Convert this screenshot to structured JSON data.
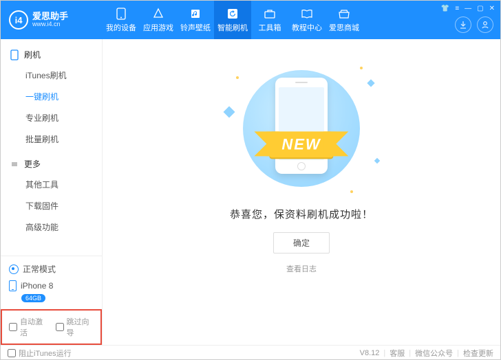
{
  "brand": {
    "logo_text": "i4",
    "title": "爱思助手",
    "url": "www.i4.cn"
  },
  "nav": {
    "items": [
      {
        "label": "我的设备",
        "icon": "phone-icon"
      },
      {
        "label": "应用游戏",
        "icon": "apps-icon"
      },
      {
        "label": "铃声壁纸",
        "icon": "music-icon"
      },
      {
        "label": "智能刷机",
        "icon": "refresh-icon",
        "active": true
      },
      {
        "label": "工具箱",
        "icon": "toolbox-icon"
      },
      {
        "label": "教程中心",
        "icon": "book-icon"
      },
      {
        "label": "爱思商城",
        "icon": "store-icon"
      }
    ]
  },
  "window_controls": {
    "cart": "⛶",
    "menu": "≡",
    "min": "—",
    "max": "▢",
    "close": "✕"
  },
  "right_circles": {
    "download": "↓",
    "user": "◯"
  },
  "sidebar": {
    "sections": [
      {
        "title": "刷机",
        "icon": "flash-icon",
        "items": [
          "iTunes刷机",
          "一键刷机",
          "专业刷机",
          "批量刷机"
        ],
        "active_index": 1
      },
      {
        "title": "更多",
        "icon": "more-icon",
        "items": [
          "其他工具",
          "下载固件",
          "高级功能"
        ]
      }
    ],
    "mode": {
      "label": "正常模式"
    },
    "device": {
      "name": "iPhone 8",
      "storage": "64GB"
    },
    "checks": {
      "auto_activate": "自动激活",
      "skip_guide": "跳过向导"
    }
  },
  "main": {
    "ribbon": "NEW",
    "success": "恭喜您，保资料刷机成功啦！",
    "ok": "确定",
    "view_log": "查看日志"
  },
  "footer": {
    "block_itunes": "阻止iTunes运行",
    "version": "V8.12",
    "support": "客服",
    "wechat": "微信公众号",
    "check_update": "检查更新"
  }
}
